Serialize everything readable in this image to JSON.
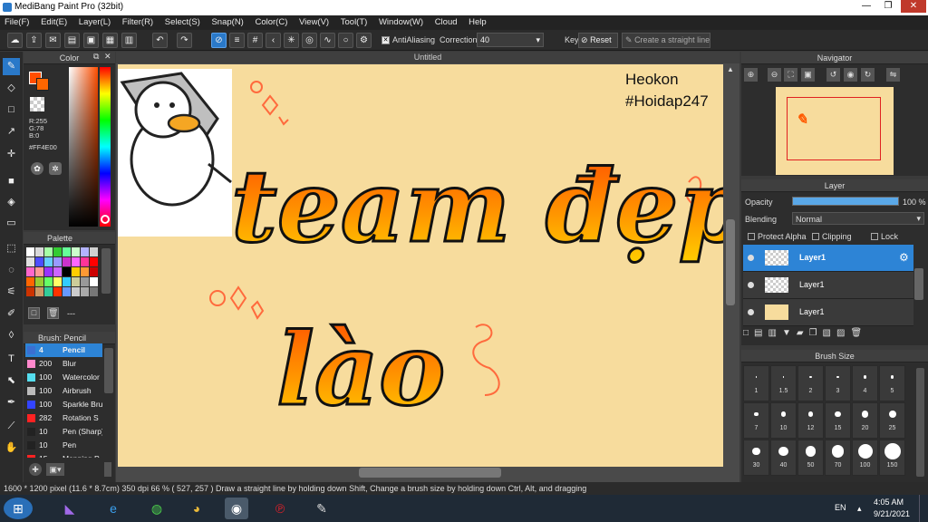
{
  "window": {
    "title": "MediBang Paint Pro (32bit)",
    "min": "—",
    "restore": "❐",
    "close": "✕"
  },
  "menu": [
    "File(F)",
    "Edit(E)",
    "Layer(L)",
    "Filter(R)",
    "Select(S)",
    "Snap(N)",
    "Color(C)",
    "View(V)",
    "Tool(T)",
    "Window(W)",
    "Cloud",
    "Help"
  ],
  "toolbar": {
    "antialiasing": "AntiAliasing",
    "correction_label": "Correction",
    "correction_value": "40",
    "key_label": "Key",
    "reset": "Reset",
    "straight_line": "Create a straight line"
  },
  "color": {
    "title": "Color",
    "r": "R:255",
    "g": "G:78",
    "b": "B:0",
    "hex": "#FF4E00",
    "fg": "#ff4e00"
  },
  "palette": {
    "title": "Palette",
    "more": "---",
    "colors": [
      "#ffffff",
      "#d9d9d9",
      "#a6ffa6",
      "#33cc33",
      "#66ff99",
      "#ccffcc",
      "#b3b3ff",
      "#d0d0d0",
      "#e0e0e0",
      "#4d4dff",
      "#66ccff",
      "#9999ff",
      "#cc33cc",
      "#ff66ff",
      "#ff3399",
      "#ff0000",
      "#ff66cc",
      "#ff9999",
      "#9933ff",
      "#cc66ff",
      "#000000",
      "#ffcc00",
      "#ff9933",
      "#cc0000",
      "#ff6600",
      "#99cc33",
      "#66ff66",
      "#ffff66",
      "#33ccff",
      "#cccc99",
      "#999999",
      "#ffffff",
      "#cc3300",
      "#cc9966",
      "#33cc99",
      "#ff3300",
      "#6699ff",
      "#cccccc",
      "#aaaaaa",
      "#777777"
    ]
  },
  "brush": {
    "title": "Brush: Pencil",
    "items": [
      {
        "size": "4",
        "label": "Pencil",
        "color": "#3b6fd1",
        "selected": true
      },
      {
        "size": "200",
        "label": "Blur",
        "color": "#ff88cc",
        "selected": false
      },
      {
        "size": "100",
        "label": "Watercolor",
        "color": "#55ddee",
        "selected": false
      },
      {
        "size": "100",
        "label": "Airbrush",
        "color": "#bbbbbb",
        "selected": false
      },
      {
        "size": "100",
        "label": "Sparkle Brush",
        "color": "#3344ff",
        "selected": false
      },
      {
        "size": "282",
        "label": "Rotation S",
        "color": "#ff2222",
        "selected": false
      },
      {
        "size": "10",
        "label": "Pen (Sharp)",
        "color": "#222222",
        "selected": false
      },
      {
        "size": "10",
        "label": "Pen",
        "color": "#222222",
        "selected": false
      },
      {
        "size": "15",
        "label": "Mapping P",
        "color": "#ff2222",
        "selected": false
      }
    ]
  },
  "canvas": {
    "tab": "Untitled",
    "watermark1": "Heokon",
    "watermark2": "#Hoidap247",
    "word1": "team đẹp",
    "word2": "lào"
  },
  "navigator": {
    "title": "Navigator"
  },
  "layer": {
    "title": "Layer",
    "opacity_label": "Opacity",
    "opacity_value": "100 %",
    "opacity": 1.0,
    "blending_label": "Blending",
    "blending_value": "Normal",
    "protect_alpha": "Protect Alpha",
    "clipping": "Clipping",
    "lock": "Lock",
    "layers": [
      {
        "name": "Layer1",
        "selected": true
      },
      {
        "name": "Layer1",
        "selected": false
      },
      {
        "name": "Layer1",
        "selected": false
      }
    ]
  },
  "brush_size": {
    "title": "Brush Size",
    "sizes": [
      "1",
      "1.5",
      "2",
      "3",
      "4",
      "5",
      "7",
      "10",
      "12",
      "15",
      "20",
      "25",
      "30",
      "40",
      "50",
      "70",
      "100",
      "150"
    ]
  },
  "status": {
    "text": "1600 * 1200 pixel  (11.6 * 8.7cm)  350 dpi  66 %  ( 527, 257 )  Draw a straight line by holding down Shift, Change a brush size by holding down Ctrl, Alt, and dragging"
  },
  "taskbar": {
    "lang": "EN",
    "time": "4:05 AM",
    "date": "9/21/2021"
  }
}
